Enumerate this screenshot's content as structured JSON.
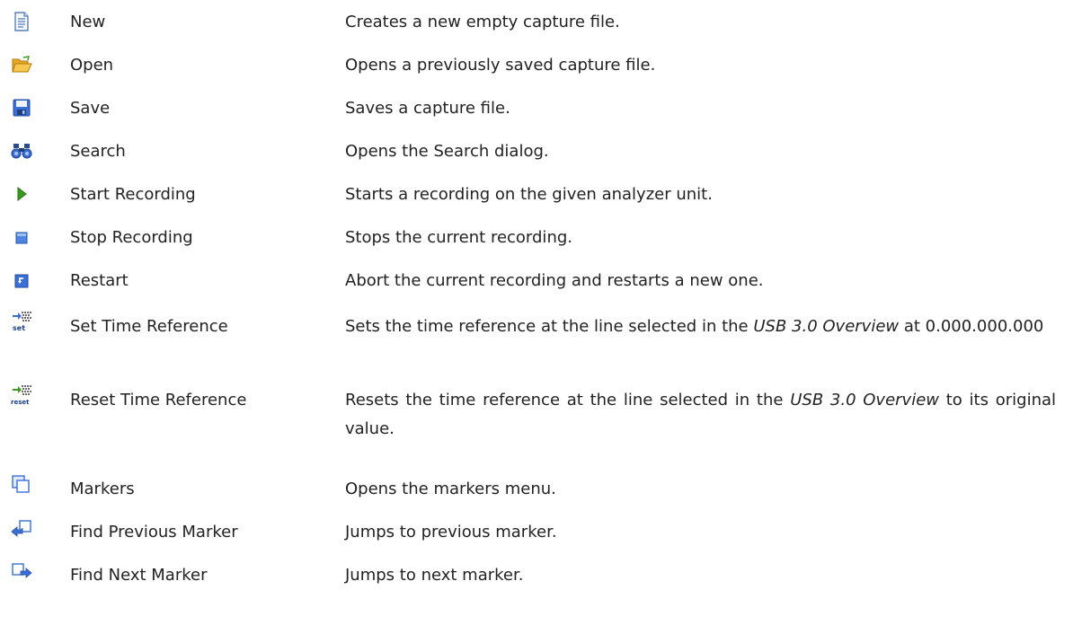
{
  "toolbar_reference": {
    "rows": [
      {
        "name": "New",
        "icon": "new-document-icon",
        "description": "Creates a new empty capture file."
      },
      {
        "name": "Open",
        "icon": "open-folder-icon",
        "description": "Opens a previously saved capture file."
      },
      {
        "name": "Save",
        "icon": "save-floppy-icon",
        "description": "Saves a capture file."
      },
      {
        "name": "Search",
        "icon": "binoculars-icon",
        "description": "Opens the Search dialog."
      },
      {
        "name": "Start Recording",
        "icon": "play-icon",
        "description": "Starts a recording on the given analyzer unit."
      },
      {
        "name": "Stop Recording",
        "icon": "stop-icon",
        "description": "Stops the current recording."
      },
      {
        "name": "Restart",
        "icon": "restart-icon",
        "description": "Abort the current recording and restarts a new one."
      },
      {
        "name": "Set Time Reference",
        "icon": "set-time-reference-icon",
        "description_parts": [
          "Sets the time reference at the line selected in the ",
          "USB 3.0 Overview",
          " at 0.000.000.000"
        ]
      },
      {
        "name": "Reset Time Reference",
        "icon": "reset-time-reference-icon",
        "description_parts": [
          "Resets the time reference at the line selected in the ",
          "USB 3.0 Overview",
          " to its original value."
        ]
      },
      {
        "name": "Markers",
        "icon": "markers-icon",
        "description": "Opens the markers menu."
      },
      {
        "name": "Find Previous Marker",
        "icon": "find-previous-marker-icon",
        "description": "Jumps to previous marker."
      },
      {
        "name": "Find Next Marker",
        "icon": "find-next-marker-icon",
        "description": "Jumps to next marker."
      }
    ]
  },
  "colors": {
    "text": "#222222",
    "icon_blue": "#3a6fd8",
    "icon_green": "#3c9a1e",
    "folder_yellow": "#f2b632"
  }
}
